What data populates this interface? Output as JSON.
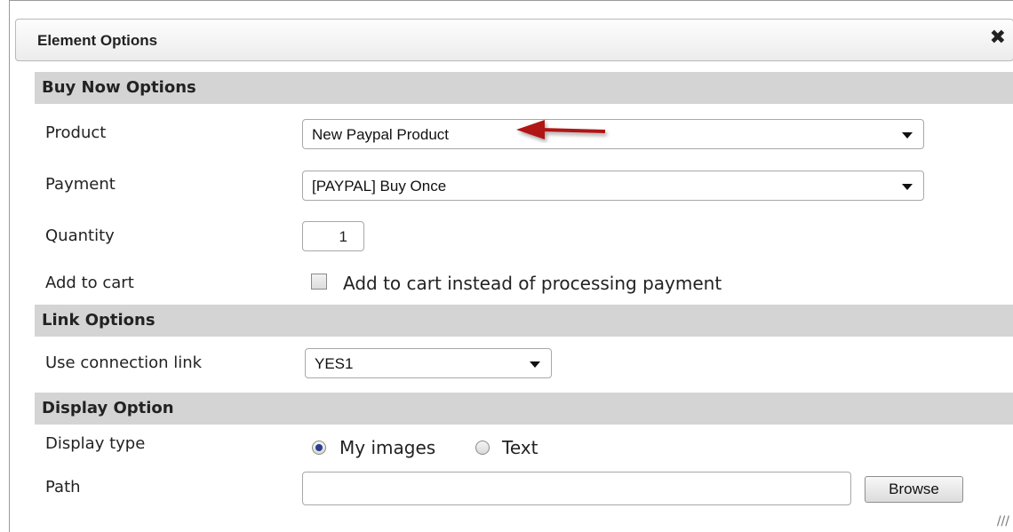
{
  "dialog": {
    "title": "Element Options",
    "close_icon": "close-icon"
  },
  "sections": {
    "buy_now": "Buy Now Options",
    "link": "Link Options",
    "display": "Display Option"
  },
  "buy_now": {
    "product_label": "Product",
    "product_value": "New Paypal Product",
    "payment_label": "Payment",
    "payment_value": "[PAYPAL] Buy Once",
    "quantity_label": "Quantity",
    "quantity_value": "1",
    "cart_label": "Add to cart",
    "cart_checkbox_label": "Add to cart instead of processing payment",
    "cart_checked": false
  },
  "link": {
    "connection_label": "Use connection link",
    "connection_value": "YES1"
  },
  "display": {
    "type_label": "Display type",
    "option_images": "My images",
    "option_text": "Text",
    "selected": "My images",
    "path_label": "Path",
    "path_value": "",
    "browse_label": "Browse"
  },
  "colors": {
    "annotation_arrow": "#b01818",
    "section_bg": "#d4d4d4"
  }
}
